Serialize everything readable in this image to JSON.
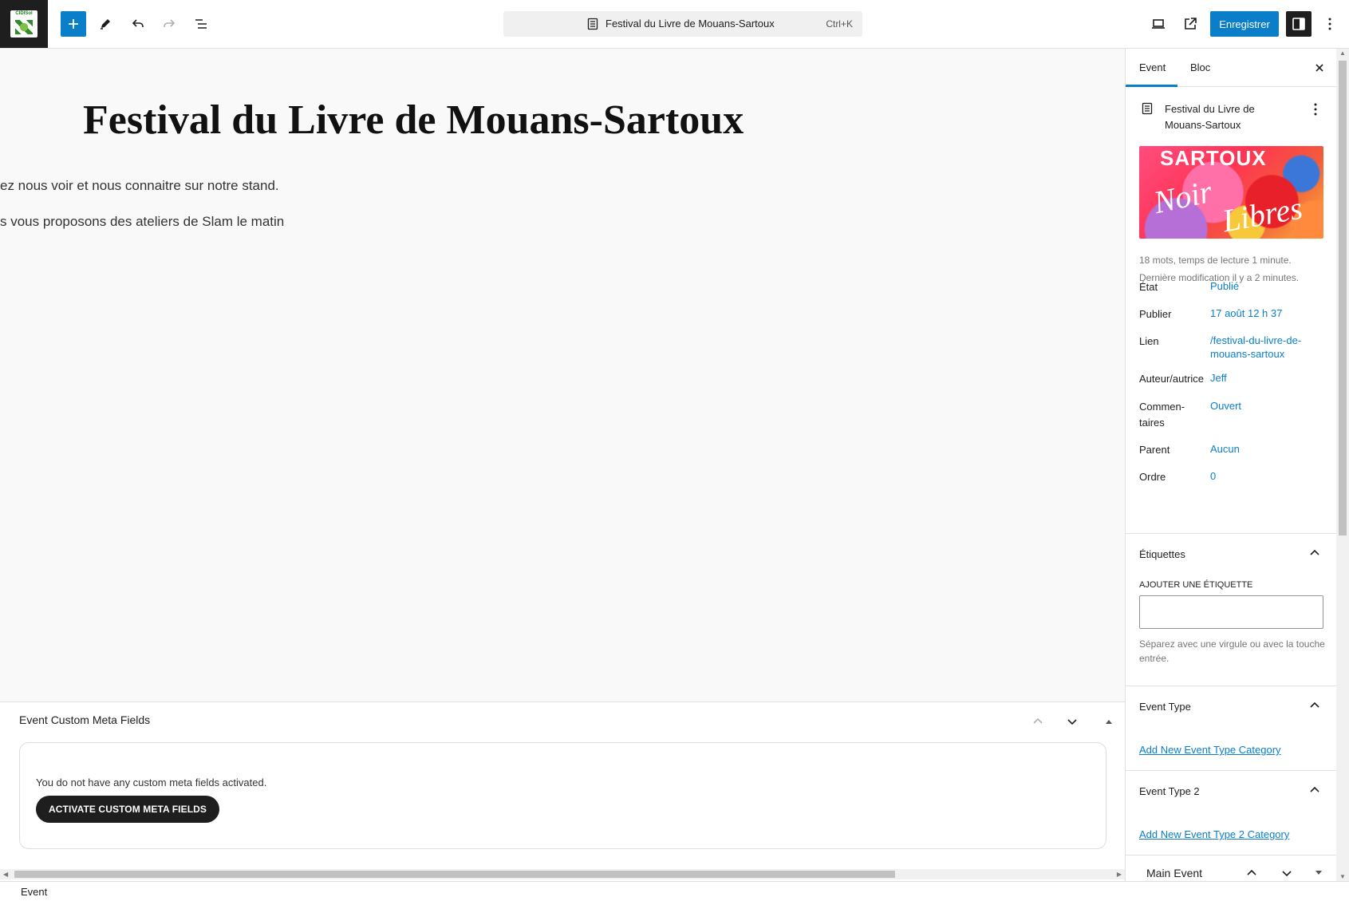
{
  "toolbar": {
    "document_title": "Festival du Livre de Mouans-Sartoux",
    "shortcut": "Ctrl+K",
    "save_label": "Enregistrer"
  },
  "editor": {
    "post_title": "Festival du Livre de Mouans-Sartoux",
    "paragraphs": [
      "ez nous voir et nous connaitre sur notre stand.",
      "s vous proposons des ateliers de Slam le matin"
    ]
  },
  "metabox": {
    "title": "Event Custom Meta Fields",
    "message": "You do not have any custom meta fields activated.",
    "button_label": "ACTIVATE CUSTOM META FIELDS"
  },
  "footer": {
    "breadcrumb": "Event"
  },
  "sidebar": {
    "tabs": [
      {
        "label": "Event",
        "active": true
      },
      {
        "label": "Bloc",
        "active": false
      }
    ],
    "post_title": "Festival du Livre de Mouans-Sartoux",
    "featured_image_text": {
      "top": "SARTOUX",
      "script_1": "Noir",
      "script_2": "Libres"
    },
    "stats": {
      "words": "18 mots, temps de lecture 1 minute.",
      "modified": "Dernière modification il y a 2 minutes."
    },
    "fields": [
      {
        "key": "État",
        "value": "Publié"
      },
      {
        "key": "Publier",
        "value": "17 août 12 h 37"
      },
      {
        "key": "Lien",
        "value": "/festival-du-livre-de-mouans-sartoux"
      },
      {
        "key": "Auteur/autrice",
        "value": "Jeff"
      },
      {
        "key": "Commen-taires",
        "value": "Ouvert"
      },
      {
        "key": "Parent",
        "value": "Aucun"
      },
      {
        "key": "Ordre",
        "value": "0"
      }
    ],
    "tags": {
      "title": "Étiquettes",
      "label": "AJOUTER UNE ÉTIQUETTE",
      "input_value": "",
      "help": "Séparez avec une virgule ou avec la touche entrée."
    },
    "event_type": {
      "title": "Event Type",
      "link": "Add New Event Type Category"
    },
    "event_type_2": {
      "title": "Event Type 2",
      "link": "Add New Event Type 2 Category"
    },
    "main_event_details": {
      "title": "Main Event Details"
    }
  },
  "colors": {
    "accent": "#0b7ec9",
    "dark": "#1e1e1e",
    "canvas_bg": "#f9f9f9"
  }
}
